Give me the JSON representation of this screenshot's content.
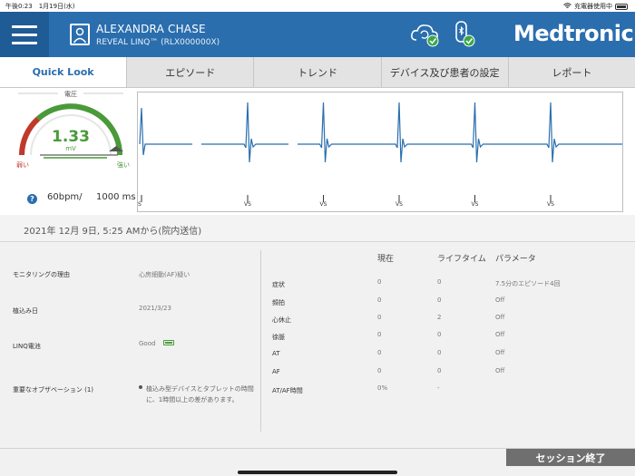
{
  "status_bar": {
    "time_date": "午後0:23　1月19日(水)",
    "charging": "充電器使用中"
  },
  "header": {
    "patient_name": "ALEXANDRA CHASE",
    "device_id": "REVEAL LINQ™ (RLX000000X)",
    "brand": "Medtronic",
    "accent_color": "#2a6eae",
    "icons": [
      "menu-icon",
      "patient-id-icon",
      "cloud-sync-icon",
      "bluetooth-device-icon"
    ]
  },
  "tabs": [
    {
      "label": "Quick Look",
      "active": true
    },
    {
      "label": "エピソード",
      "active": false
    },
    {
      "label": "トレンド",
      "active": false
    },
    {
      "label": "デバイス及び患者の設定",
      "active": false
    },
    {
      "label": "レポート",
      "active": false
    }
  ],
  "gauge": {
    "title": "電圧",
    "value": "1.33",
    "unit": "mV",
    "low_label": "弱い",
    "high_label": "強い",
    "level_fraction": 0.88
  },
  "rate": {
    "bpm": "60bpm/",
    "ms": "1000 ms"
  },
  "ecg": {
    "beats": 6,
    "marker_label": "VS"
  },
  "date_line": "2021年 12月 9日, 5:25 AMから(院内送信)",
  "patient_info": {
    "monitoring_reason": {
      "label": "モニタリングの理由",
      "value": "心房細動(AF)疑い"
    },
    "implant_date": {
      "label": "植込み日",
      "value": "2021/3/23"
    },
    "battery": {
      "label": "LINQ電池",
      "value": "Good"
    },
    "observation": {
      "label": "重要なオブザベーション (1)",
      "value": "植込み型デバイスとタブレットの時間に、1時間以上の差があります。"
    }
  },
  "episode_table": {
    "headers": [
      "現在",
      "ライフタイム",
      "パラメータ"
    ],
    "rows": [
      {
        "label": "症状",
        "current": "0",
        "lifetime": "0",
        "param": "7.5分のエピソード4回"
      },
      {
        "label": "頻拍",
        "current": "0",
        "lifetime": "0",
        "param": "Off"
      },
      {
        "label": "心休止",
        "current": "0",
        "lifetime": "2",
        "param": "Off"
      },
      {
        "label": "徐脈",
        "current": "0",
        "lifetime": "0",
        "param": "Off"
      },
      {
        "label": "AT",
        "current": "0",
        "lifetime": "0",
        "param": "Off"
      },
      {
        "label": "AF",
        "current": "0",
        "lifetime": "0",
        "param": "Off"
      },
      {
        "label": "AT/AF時間",
        "current": "0%",
        "lifetime": "-",
        "param": ""
      }
    ]
  },
  "end_session": "セッション終了"
}
